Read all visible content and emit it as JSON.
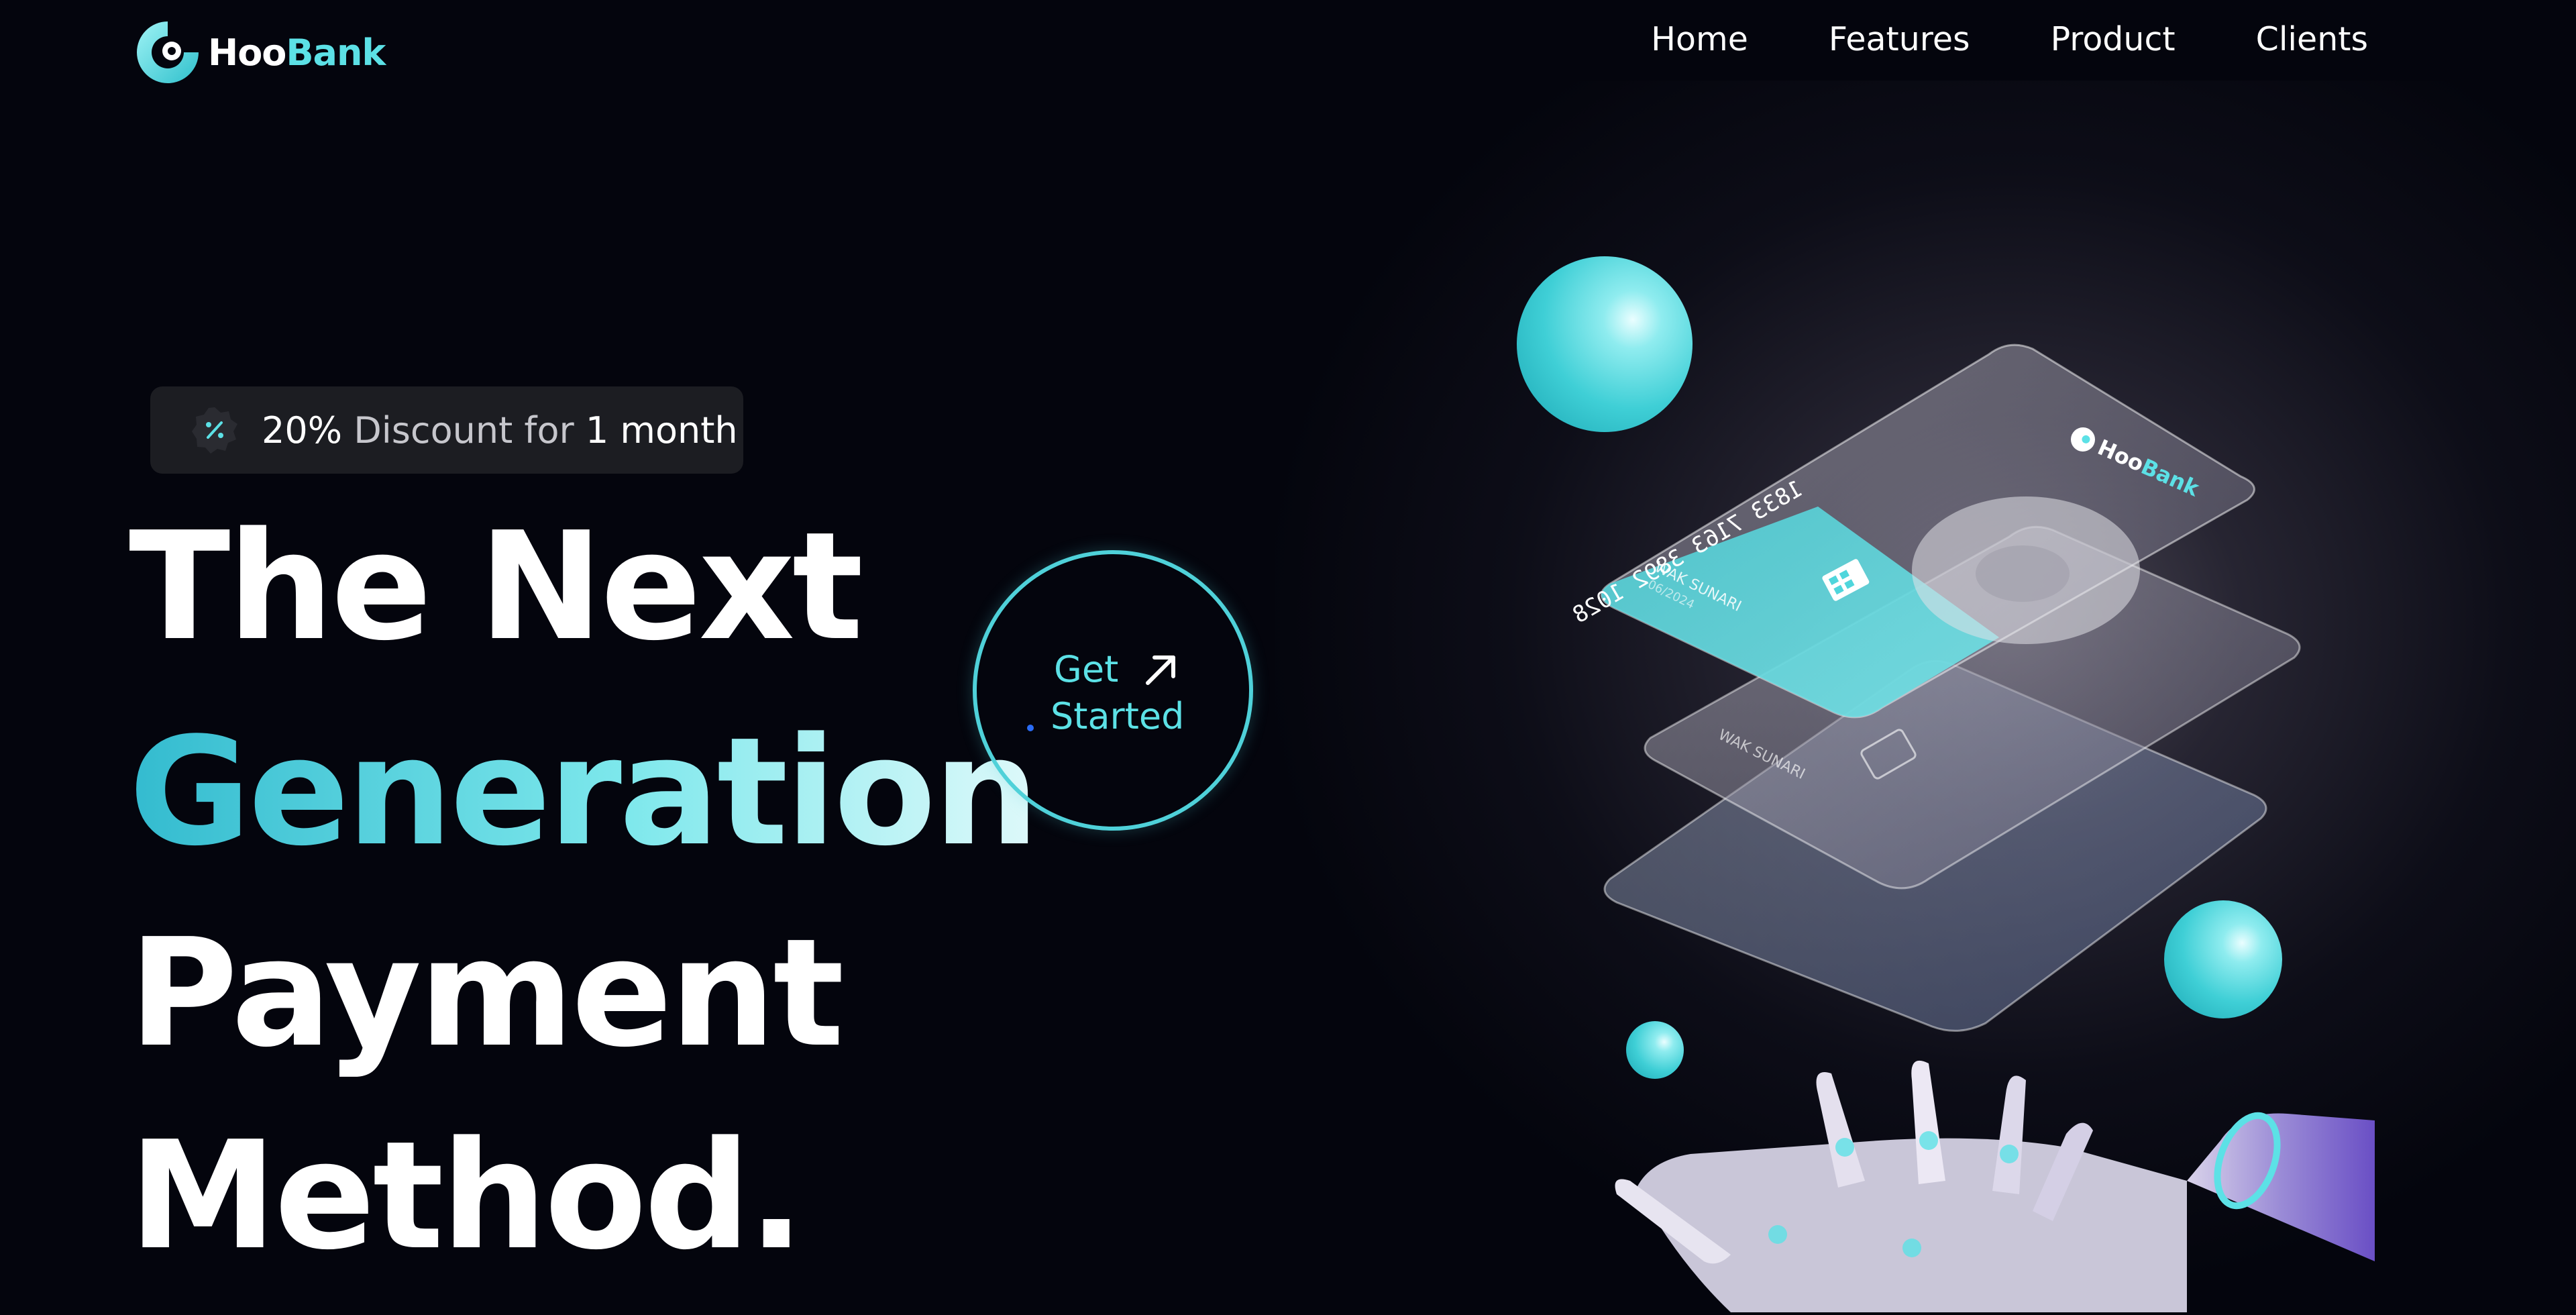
{
  "brand": {
    "name_part1": "Hoo",
    "name_part2": "Bank",
    "accent": "#5ce1e6",
    "logo_icon": "hoobank-logo-icon"
  },
  "nav": {
    "items": [
      "Home",
      "Features",
      "Product",
      "Clients"
    ]
  },
  "badge": {
    "pct": "20%",
    "label": " Discount for ",
    "num": "1",
    "period": " month",
    "icon": "discount-icon"
  },
  "hero": {
    "line1": "The Next",
    "line2": "Generation",
    "line3": "Payment",
    "line4": "Method."
  },
  "cta": {
    "line1": "Get",
    "line2": "Started",
    "icon": "arrow-up-right-icon"
  },
  "illustration": {
    "card_number": "1833 7163 3892 1028",
    "card_holder": "WAK SUNARI",
    "card_expiry": "06/2024",
    "card_brand_1": "Hoo",
    "card_brand_2": "Bank"
  },
  "colors": {
    "background": "#04050d",
    "teal": "#5ce1e6",
    "badge_bg": "#1c1d22"
  }
}
